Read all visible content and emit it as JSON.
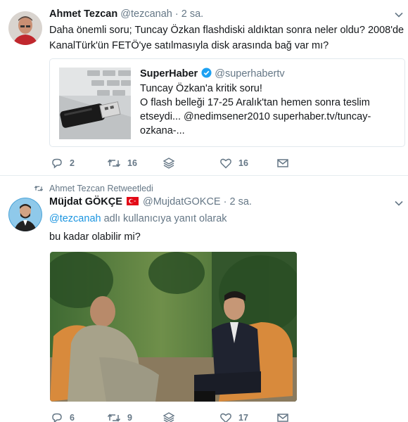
{
  "tweet1": {
    "name": "Ahmet Tezcan",
    "handle": "@tezcanah",
    "dot": "·",
    "time": "2 sa.",
    "text_line1": "Daha önemli soru; Tuncay Özkan flashdiski aldıktan sonra neler oldu? 2008'de",
    "text_line2": "KanalTürk'ün FETÖ'ye satılmasıyla disk arasında bağ var mı?",
    "quote": {
      "name": "SuperHaber",
      "handle": "@superhabertv",
      "line1": "Tuncay Özkan'a kritik soru!",
      "line2": "O flash belleği 17-25 Aralık'tan hemen sonra teslim",
      "line3": "etseydi... @nedimsener2010 superhaber.tv/tuncay-",
      "line4": "ozkana-..."
    },
    "actions": {
      "replies": "2",
      "retweets": "16",
      "likes": "16"
    }
  },
  "tweet2": {
    "retweeted_by": "Ahmet Tezcan Retweetledi",
    "name": "Müjdat GÖKÇE",
    "flag": "turkey-flag",
    "handle": "@MujdatGOKCE",
    "dot": "·",
    "time": "2 sa.",
    "reply_mention": "@tezcanah",
    "reply_suffix": "adlı kullanıcıya yanıt olarak",
    "text": "bu kadar olabilir mi?",
    "actions": {
      "replies": "6",
      "retweets": "9",
      "likes": "17"
    }
  },
  "colors": {
    "accent": "#1b95e0",
    "muted": "#657786",
    "border": "#e6ecf0",
    "verified": "#1da1f2"
  }
}
